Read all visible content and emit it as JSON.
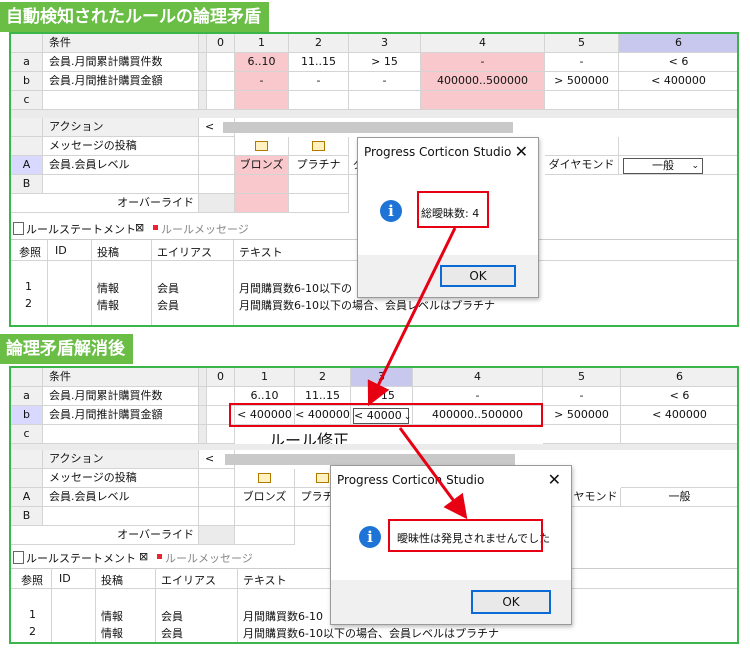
{
  "before": {
    "label": "自動検知されたルールの論理矛盾",
    "columns": [
      "0",
      "1",
      "2",
      "3",
      "4",
      "5",
      "6"
    ],
    "conditions_header": "条件",
    "conditions": [
      {
        "letter": "a",
        "name": "会員.月間累計購買件数",
        "values": [
          "",
          "6..10",
          "11..15",
          "> 15",
          "-",
          "-",
          "< 6"
        ]
      },
      {
        "letter": "b",
        "name": "会員.月間推計購買金額",
        "values": [
          "",
          "-",
          "-",
          "-",
          "400000..500000",
          "> 500000",
          "< 400000"
        ]
      },
      {
        "letter": "c",
        "name": "",
        "values": [
          "",
          "",
          "",
          "",
          "",
          "",
          ""
        ]
      }
    ],
    "actions_header": "アクション",
    "message_post": "メッセージの投稿",
    "action_letter_a": "A",
    "action_letter_b": "B",
    "action_name": "会員.会員レベル",
    "action_values": [
      "",
      "ブロンズ",
      "プラチナ",
      "ダ",
      "",
      "ダイヤモンド",
      "一般"
    ],
    "override": "オーバーライド",
    "scroll_left": "<",
    "tabs": {
      "statement": "ルールステートメント",
      "close": "⊠",
      "message": "ルールメッセージ"
    },
    "table_headers": [
      "参照",
      "ID",
      "投稿",
      "エイリアス",
      "テキスト"
    ],
    "rows": [
      {
        "ref": "1",
        "post": "情報",
        "alias": "会員",
        "text": "月間購買数6-10以下の"
      },
      {
        "ref": "2",
        "post": "情報",
        "alias": "会員",
        "text": "月間購買数6-10以下の場合、会員レベルはプラチナ"
      }
    ],
    "dialog": {
      "title": "Progress Corticon Studio",
      "close": "✕",
      "message": "総曖昧数: 4",
      "ok": "OK"
    }
  },
  "after": {
    "label": "論理矛盾解消後",
    "columns": [
      "0",
      "1",
      "2",
      "3",
      "4",
      "5",
      "6"
    ],
    "conditions_header": "条件",
    "conditions": [
      {
        "letter": "a",
        "name": "会員.月間累計購買件数",
        "values": [
          "",
          "6..10",
          "11..15",
          "> 15",
          "-",
          "-",
          "< 6"
        ]
      },
      {
        "letter": "b",
        "name": "会員.月間推計購買金額",
        "values": [
          "",
          "< 400000",
          "< 400000",
          "< 40000",
          "400000..500000",
          "> 500000",
          "< 400000"
        ]
      },
      {
        "letter": "c",
        "name": "",
        "values": [
          "",
          "",
          "",
          "",
          "",
          "",
          ""
        ]
      }
    ],
    "fix_label": "ルール修正",
    "actions_header": "アクション",
    "message_post": "メッセージの投稿",
    "action_letter_a": "A",
    "action_letter_b": "B",
    "action_name": "会員.会員レベル",
    "action_values": [
      "",
      "ブロンズ",
      "プラチナ",
      "",
      "",
      "ヤモンド",
      "一般"
    ],
    "override": "オーバーライド",
    "scroll_left": "<",
    "tabs": {
      "statement": "ルールステートメント",
      "close": "⊠",
      "message": "ルールメッセージ"
    },
    "table_headers": [
      "参照",
      "ID",
      "投稿",
      "エイリアス",
      "テキスト"
    ],
    "rows": [
      {
        "ref": "1",
        "post": "情報",
        "alias": "会員",
        "text": "月間購買数6-10"
      },
      {
        "ref": "2",
        "post": "情報",
        "alias": "会員",
        "text": "月間購買数6-10以下の場合、会員レベルはプラチナ"
      }
    ],
    "dialog": {
      "title": "Progress Corticon Studio",
      "close": "✕",
      "message": "曖昧性は発見されませんでした",
      "ok": "OK"
    }
  },
  "colors": {
    "panel_border": "#39b54a",
    "label_bg": "#6abd45",
    "highlight_red": "#e60012",
    "conflict_pink": "#f8c8cc",
    "selected_col": "#c8c8ee",
    "info_blue": "#1d73d6"
  }
}
